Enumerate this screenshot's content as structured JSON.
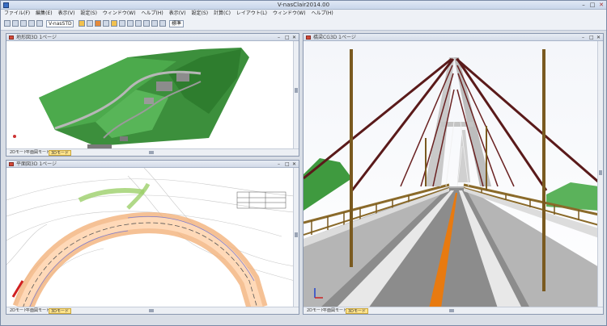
{
  "window": {
    "title": "V-nasClair2014.00"
  },
  "menu": {
    "items": [
      "ファイル(F)",
      "編集(E)",
      "表示(V)",
      "設定(S)",
      "ウィンドウ(W)",
      "ヘルプ(H)",
      "表示(V)",
      "設定(S)",
      "計算(C)",
      "レイアウト(L)",
      "ウィンドウ(W)",
      "ヘルプ(H)"
    ]
  },
  "toolbar": {
    "dropdown1": "V-nasSTD",
    "dropdown2": "標準"
  },
  "panels": {
    "topleft": {
      "title": "地形図3D  1ページ",
      "tabs": [
        "2Dモード",
        "平面図モード",
        "3Dモード"
      ]
    },
    "bottomleft": {
      "title": "平面図3D  1ページ",
      "tabs": [
        "2Dモード",
        "平面図モード",
        "3Dモード"
      ]
    },
    "right": {
      "title": "橋梁CG3D  1ページ",
      "tabs": [
        "2Dモード",
        "平面図モード",
        "3Dモード"
      ]
    }
  },
  "colors": {
    "active_tab": "#ffe38a",
    "terrain_green": "#3a9a3a",
    "road_orange": "#e87a10"
  }
}
